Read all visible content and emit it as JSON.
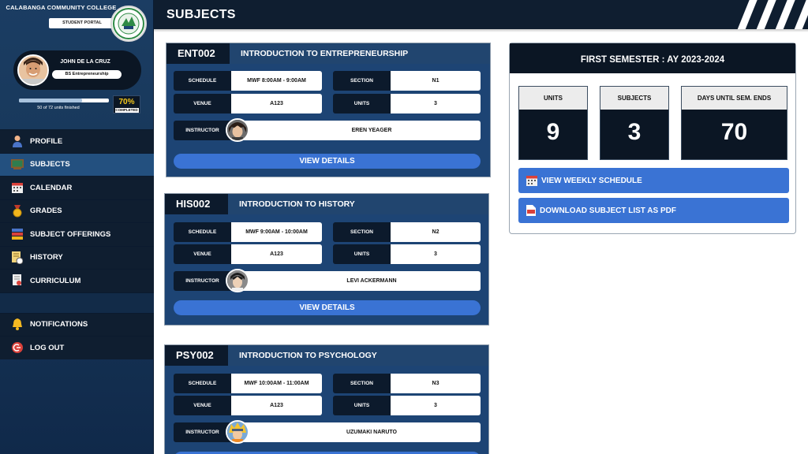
{
  "sidebar": {
    "college_name": "CALABANGA COMMUNITY COLLEGE",
    "portal_label": "STUDENT PORTAL",
    "user": {
      "name": "JOHN DE LA CRUZ",
      "course": "BS Entrepreneurship"
    },
    "progress": {
      "text": "50 of 72 units finished",
      "percent": "70%",
      "percent_fraction": 0.7,
      "completed_label": "COMPLETED"
    },
    "nav": [
      {
        "label": "PROFILE",
        "icon": "user-icon"
      },
      {
        "label": "SUBJECTS",
        "icon": "chalkboard-icon",
        "active": true
      },
      {
        "label": "CALENDAR",
        "icon": "calendar-icon"
      },
      {
        "label": "GRADES",
        "icon": "medal-icon"
      },
      {
        "label": "SUBJECT OFFERINGS",
        "icon": "books-icon"
      },
      {
        "label": "HISTORY",
        "icon": "document-history-icon"
      },
      {
        "label": "CURRICULUM",
        "icon": "certificate-icon"
      }
    ],
    "nav_bottom": [
      {
        "label": "NOTIFICATIONS",
        "icon": "bell-icon"
      },
      {
        "label": "LOG OUT",
        "icon": "logout-icon"
      }
    ]
  },
  "header": {
    "title": "SUBJECTS"
  },
  "labels": {
    "schedule": "SCHEDULE",
    "section": "SECTION",
    "venue": "VENUE",
    "units": "UNITS",
    "instructor": "INSTRUCTOR",
    "view_details": "VIEW DETAILS"
  },
  "subjects": [
    {
      "code": "ENT002",
      "title": "INTRODUCTION TO ENTREPRENEURSHIP",
      "schedule": "MWF 8:00AM - 9:00AM",
      "section": "N1",
      "venue": "A123",
      "units": "3",
      "instructor": "EREN YEAGER"
    },
    {
      "code": "HIS002",
      "title": "INTRODUCTION TO HISTORY",
      "schedule": "MWF 9:00AM - 10:00AM",
      "section": "N2",
      "venue": "A123",
      "units": "3",
      "instructor": "LEVI ACKERMANN"
    },
    {
      "code": "PSY002",
      "title": "INTRODUCTION TO PSYCHOLOGY",
      "schedule": "MWF 10:00AM - 11:00AM",
      "section": "N3",
      "venue": "A123",
      "units": "3",
      "instructor": "UZUMAKI NARUTO"
    }
  ],
  "semester": {
    "title": "FIRST SEMESTER : AY 2023-2024",
    "stats": [
      {
        "label": "UNITS",
        "value": "9"
      },
      {
        "label": "SUBJECTS",
        "value": "3"
      },
      {
        "label": "DAYS UNTIL SEM. ENDS",
        "value": "70"
      }
    ],
    "buttons": {
      "weekly": "VIEW WEEKLY SCHEDULE",
      "download": "DOWNLOAD SUBJECT LIST AS PDF"
    }
  },
  "colors": {
    "accent_button": "#3a73d4",
    "sidebar": "#163556",
    "dark_navy": "#0b1624",
    "percent_yellow": "#f5c81a"
  }
}
